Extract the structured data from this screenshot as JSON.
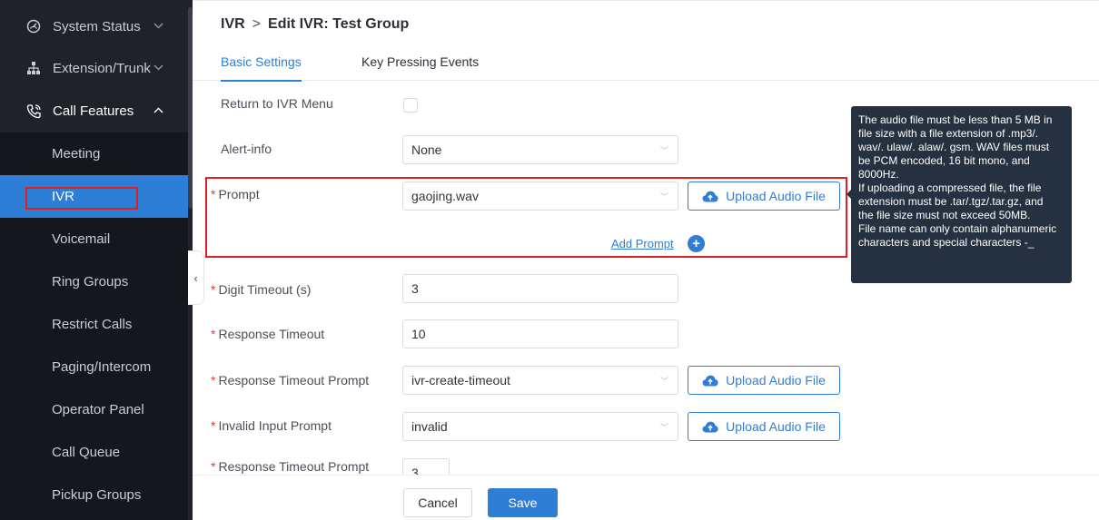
{
  "sidebar": {
    "groups": [
      {
        "label": "System Status",
        "icon": "gauge-icon",
        "chevron": "chevron-down-icon"
      },
      {
        "label": "Extension/Trunk",
        "icon": "network-icon",
        "chevron": "chevron-down-icon"
      },
      {
        "label": "Call Features",
        "icon": "phone-icon",
        "chevron": "chevron-up-icon"
      }
    ],
    "items": [
      {
        "label": "Meeting"
      },
      {
        "label": "IVR"
      },
      {
        "label": "Voicemail"
      },
      {
        "label": "Ring Groups"
      },
      {
        "label": "Restrict Calls"
      },
      {
        "label": "Paging/Intercom"
      },
      {
        "label": "Operator Panel"
      },
      {
        "label": "Call Queue"
      },
      {
        "label": "Pickup Groups"
      }
    ],
    "collapse_glyph": "‹"
  },
  "header": {
    "breadcrumb_root": "IVR",
    "breadcrumb_sep": ">",
    "breadcrumb_current": "Edit IVR: Test Group"
  },
  "tabs": [
    {
      "label": "Basic Settings",
      "active": true
    },
    {
      "label": "Key Pressing Events",
      "active": false
    }
  ],
  "form": {
    "return_to_ivr": {
      "label": "Return to IVR Menu",
      "checked": false
    },
    "alert_info": {
      "label": "Alert-info",
      "value": "None"
    },
    "prompt": {
      "label": "Prompt",
      "value": "gaojing.wav",
      "upload_label": "Upload Audio File",
      "add_label": "Add Prompt"
    },
    "digit_timeout": {
      "label": "Digit Timeout (s)",
      "value": "3"
    },
    "response_timeout": {
      "label": "Response Timeout",
      "value": "10"
    },
    "response_timeout_prompt": {
      "label": "Response Timeout Prompt",
      "value": "ivr-create-timeout",
      "upload_label": "Upload Audio File"
    },
    "invalid_input_prompt": {
      "label": "Invalid Input Prompt",
      "value": "invalid",
      "upload_label": "Upload Audio File"
    },
    "response_timeout_prompt_repeat": {
      "label": "Response Timeout Prompt",
      "value": "3"
    },
    "required_mark": "*",
    "arrow_glyph": "﹀"
  },
  "footer": {
    "cancel_label": "Cancel",
    "save_label": "Save"
  },
  "tooltip": {
    "lines": [
      "The audio file must be less than 5 MB in",
      "file size with a file extension of .mp3/.",
      "wav/. ulaw/. alaw/. gsm. WAV files must",
      "be PCM encoded, 16 bit mono, and",
      "8000Hz.",
      "If uploading a compressed file, the file",
      "extension must be .tar/.tgz/.tar.gz, and",
      "the file size must not exceed 50MB.",
      "File name can only contain alphanumeric",
      "characters and special characters -_"
    ]
  },
  "colors": {
    "accent": "#2e7dd7",
    "sidebar_bg": "#1f2229",
    "highlight": "#e02020",
    "tooltip_bg": "#253041"
  }
}
